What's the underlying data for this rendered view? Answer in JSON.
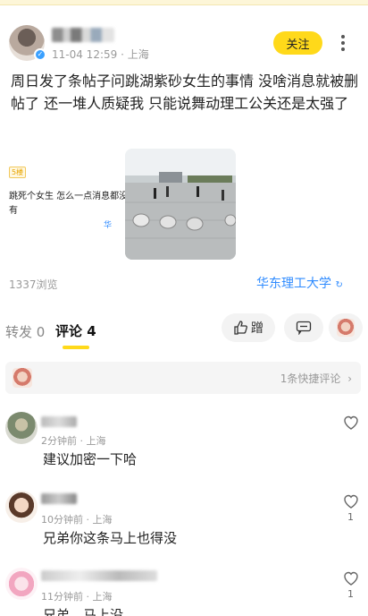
{
  "header": {
    "meta": "11-04 12:59 · 上海",
    "follow_label": "关注"
  },
  "post": {
    "text": "周日发了条帖子问跳湖紫砂女生的事情 没啥消息就被删帖了 还一堆人质疑我 只能说舞动理工公关还是太强了",
    "views": "1337浏览",
    "school_tag": "华东理工大学"
  },
  "embed": {
    "tag": "5楼",
    "line1": "跳死个女生 怎么一点消息都没",
    "line2": "有",
    "tag2": "华"
  },
  "tabs": {
    "repost_label": "转发 0",
    "comment_label": "评论 4",
    "like_label": "蹭"
  },
  "quick_comment": {
    "label": "1条快捷评论"
  },
  "comments": [
    {
      "meta": "2分钟前 · 上海",
      "text": "建议加密一下哈",
      "likes": ""
    },
    {
      "meta": "10分钟前 · 上海",
      "text": "兄弟你这条马上也得没",
      "likes": "1"
    },
    {
      "meta": "11分钟前 · 上海",
      "text": "兄弟，马上没",
      "likes": "1"
    }
  ],
  "colors": {
    "accent_yellow": "#ffd91a",
    "link_blue": "#2f8bff",
    "meta_grey": "#9a9a9a"
  },
  "icons": [
    "more-vertical-icon",
    "heart-icon",
    "message-icon",
    "verified-badge-icon",
    "chevron-right-icon",
    "refresh-icon"
  ]
}
